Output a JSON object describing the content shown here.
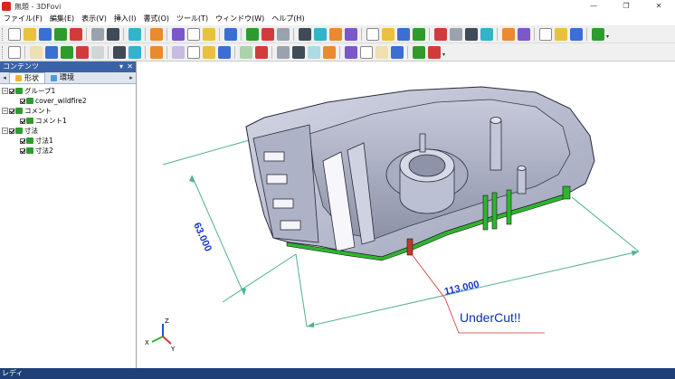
{
  "window": {
    "title": "無題 - 3DFovi",
    "minimize": "—",
    "maximize": "❐",
    "close": "✕"
  },
  "menu": [
    "ファイル(F)",
    "編集(E)",
    "表示(V)",
    "挿入(I)",
    "書式(O)",
    "ツール(T)",
    "ウィンドウ(W)",
    "ヘルプ(H)"
  ],
  "toolbar1": {
    "groups": [
      [
        "new-icon",
        "open-icon",
        "save-icon",
        "save-as-icon",
        "print-icon"
      ],
      [
        "undo-icon",
        "redo-icon"
      ],
      [
        "delete-icon"
      ],
      [
        "grid-icon"
      ],
      [
        "box-view-icon",
        "fit-view-icon",
        "measure-icon"
      ],
      [
        "help-icon"
      ],
      [
        "document-icon",
        "cut-icon",
        "section-icon"
      ],
      [
        "green-cube-icon",
        "green-cube-front-icon",
        "green-cube-side-icon",
        "green-cube-back-icon"
      ],
      [
        "arrow-up-icon",
        "arrow-down-icon",
        "arrow-left-icon",
        "arrow-right-icon"
      ],
      [
        "rotate-x-icon",
        "rotate-y-icon",
        "rotate-z-icon",
        "rotate-free-icon"
      ],
      [
        "zoom-icon",
        "pan-icon"
      ],
      [
        "pick-icon",
        "highlight-icon",
        "paint-icon"
      ],
      [
        "fullscreen-icon"
      ]
    ]
  },
  "toolbar2": {
    "groups": [
      [
        "select-icon"
      ],
      [
        "view-front-icon",
        "view-top-icon",
        "view-right-icon",
        "view-iso-icon",
        "view-back-icon"
      ],
      [
        "align-icon",
        "split-icon"
      ],
      [
        "light-icon"
      ],
      [
        "flag-icon",
        "camera-icon",
        "pointer-icon",
        "marker-icon"
      ],
      [
        "measure-distance-icon",
        "measure-angle-icon"
      ],
      [
        "wrench-icon",
        "probe-icon",
        "target-icon",
        "network-icon"
      ],
      [
        "search-model-icon",
        "move-icon",
        "explode-icon",
        "sphere-icon"
      ],
      [
        "snapshot-icon",
        "export-icon"
      ]
    ]
  },
  "panel": {
    "title": "コンテンツ",
    "pin": "▾",
    "close": "✕",
    "tabs": [
      "形状",
      "環境"
    ],
    "tree": [
      {
        "level": 0,
        "expander": "−",
        "label": "グループ1",
        "icon": "group-icon",
        "color": "#2f9b2f"
      },
      {
        "level": 1,
        "expander": "",
        "label": "cover_wildfire2",
        "icon": "part-icon",
        "color": "#2f9b2f"
      },
      {
        "level": 0,
        "expander": "−",
        "label": "コメント",
        "icon": "comment-folder-icon",
        "color": "#2f9b2f"
      },
      {
        "level": 1,
        "expander": "",
        "label": "コメント1",
        "icon": "comment-icon",
        "color": "#2f9b2f"
      },
      {
        "level": 0,
        "expander": "−",
        "label": "寸法",
        "icon": "dimension-folder-icon",
        "color": "#2f9b2f"
      },
      {
        "level": 1,
        "expander": "",
        "label": "寸法1",
        "icon": "dimension-icon",
        "color": "#2f9b2f"
      },
      {
        "level": 1,
        "expander": "",
        "label": "寸法2",
        "icon": "dimension-icon",
        "color": "#2f9b2f"
      }
    ]
  },
  "viewport": {
    "dimension_1": "63.000",
    "dimension_2": "113.000",
    "annotation": "UnderCut!!",
    "triad": {
      "x": "X",
      "y": "Y",
      "z": "Z"
    },
    "dimension_color": "#1a35c8",
    "annotation_color": "#0d2fb5",
    "leader_color": "#d43030",
    "extension_color": "#4fb38c"
  },
  "status": {
    "text": "レディ"
  },
  "colors": {
    "panel_header": "#3a63a5",
    "statusbar": "#1e3f78",
    "model_fill": "#bfc3d6",
    "model_edge": "#2a2a3a",
    "cut_face": "#2fb52f"
  }
}
